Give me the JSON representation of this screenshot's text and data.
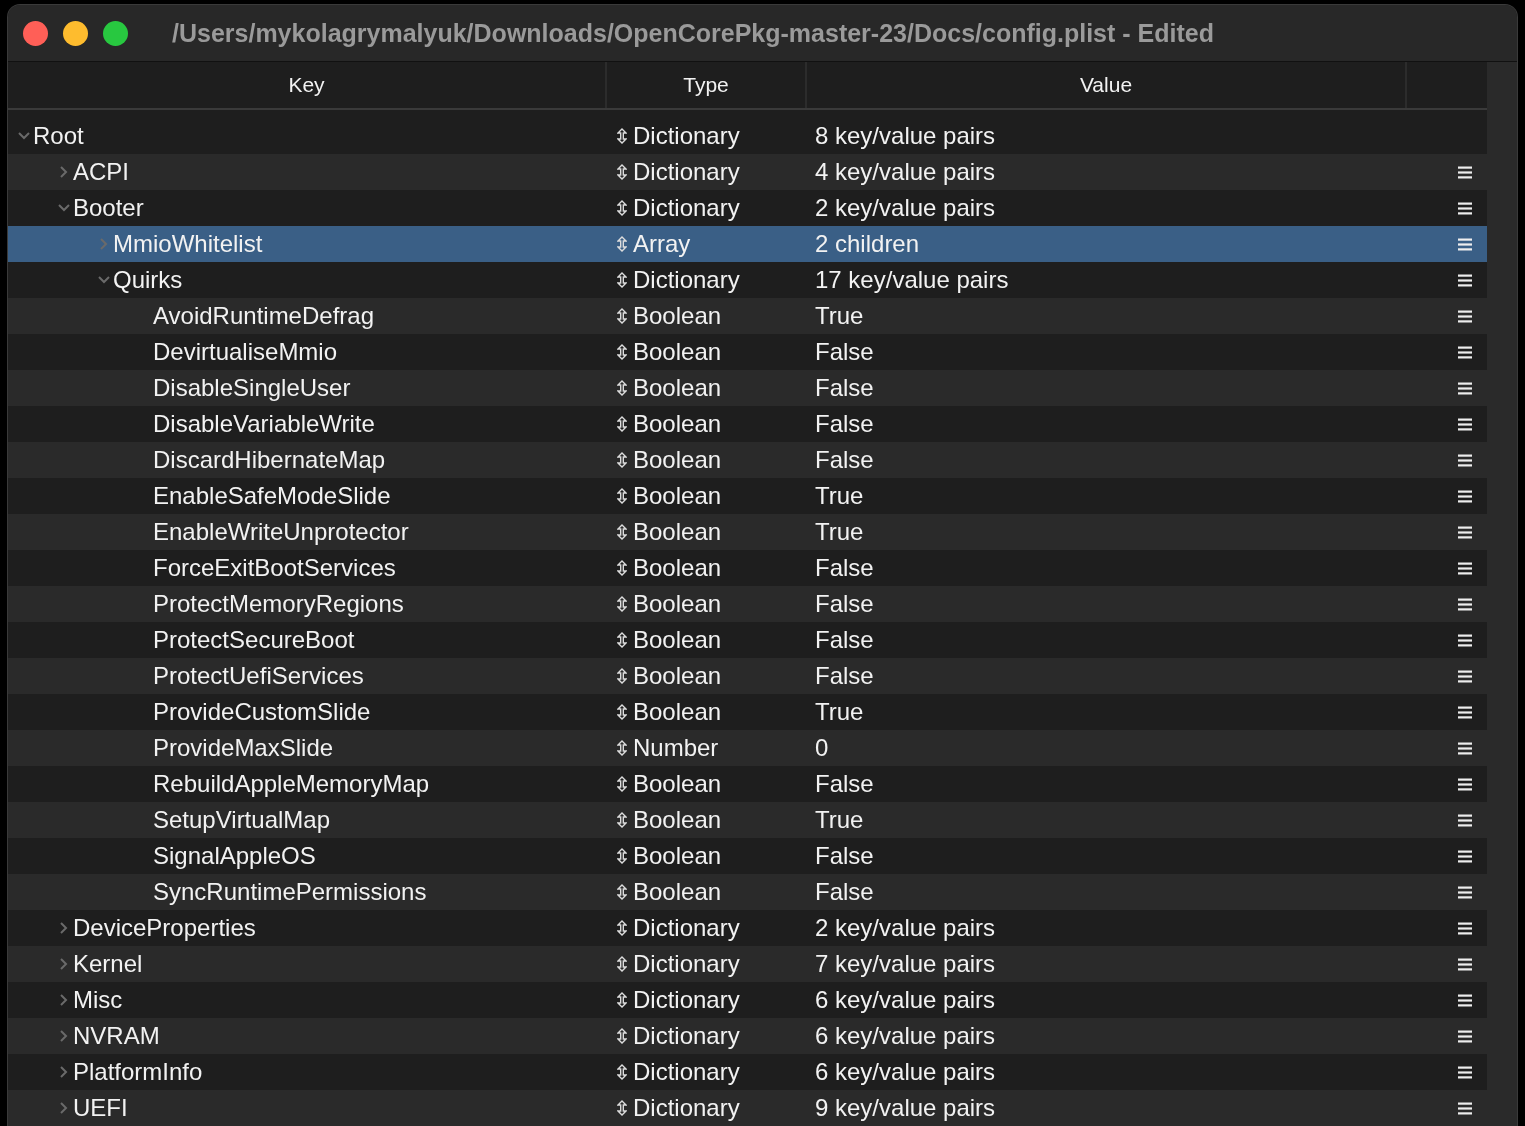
{
  "window": {
    "title": "/Users/mykolagrymalyuk/Downloads/OpenCorePkg-master-23/Docs/config.plist - Edited"
  },
  "table": {
    "columns": [
      "Key",
      "Type",
      "Value"
    ],
    "rows": [
      {
        "key": "Root",
        "type": "Dictionary",
        "value": "8 key/value pairs",
        "expanded": true,
        "selected": false,
        "children": [
          {
            "key": "ACPI",
            "type": "Dictionary",
            "value": "4 key/value pairs",
            "expanded": false,
            "selected": false
          },
          {
            "key": "Booter",
            "type": "Dictionary",
            "value": "2 key/value pairs",
            "expanded": true,
            "selected": false,
            "children": [
              {
                "key": "MmioWhitelist",
                "type": "Array",
                "value": "2 children",
                "expanded": false,
                "selected": true
              },
              {
                "key": "Quirks",
                "type": "Dictionary",
                "value": "17 key/value pairs",
                "expanded": true,
                "selected": false,
                "children": [
                  {
                    "key": "AvoidRuntimeDefrag",
                    "type": "Boolean",
                    "value": "True",
                    "selected": false
                  },
                  {
                    "key": "DevirtualiseMmio",
                    "type": "Boolean",
                    "value": "False",
                    "selected": false
                  },
                  {
                    "key": "DisableSingleUser",
                    "type": "Boolean",
                    "value": "False",
                    "selected": false
                  },
                  {
                    "key": "DisableVariableWrite",
                    "type": "Boolean",
                    "value": "False",
                    "selected": false
                  },
                  {
                    "key": "DiscardHibernateMap",
                    "type": "Boolean",
                    "value": "False",
                    "selected": false
                  },
                  {
                    "key": "EnableSafeModeSlide",
                    "type": "Boolean",
                    "value": "True",
                    "selected": false
                  },
                  {
                    "key": "EnableWriteUnprotector",
                    "type": "Boolean",
                    "value": "True",
                    "selected": false
                  },
                  {
                    "key": "ForceExitBootServices",
                    "type": "Boolean",
                    "value": "False",
                    "selected": false
                  },
                  {
                    "key": "ProtectMemoryRegions",
                    "type": "Boolean",
                    "value": "False",
                    "selected": false
                  },
                  {
                    "key": "ProtectSecureBoot",
                    "type": "Boolean",
                    "value": "False",
                    "selected": false
                  },
                  {
                    "key": "ProtectUefiServices",
                    "type": "Boolean",
                    "value": "False",
                    "selected": false
                  },
                  {
                    "key": "ProvideCustomSlide",
                    "type": "Boolean",
                    "value": "True",
                    "selected": false
                  },
                  {
                    "key": "ProvideMaxSlide",
                    "type": "Number",
                    "value": "0",
                    "selected": false
                  },
                  {
                    "key": "RebuildAppleMemoryMap",
                    "type": "Boolean",
                    "value": "False",
                    "selected": false
                  },
                  {
                    "key": "SetupVirtualMap",
                    "type": "Boolean",
                    "value": "True",
                    "selected": false
                  },
                  {
                    "key": "SignalAppleOS",
                    "type": "Boolean",
                    "value": "False",
                    "selected": false
                  },
                  {
                    "key": "SyncRuntimePermissions",
                    "type": "Boolean",
                    "value": "False",
                    "selected": false
                  }
                ]
              }
            ]
          },
          {
            "key": "DeviceProperties",
            "type": "Dictionary",
            "value": "2 key/value pairs",
            "expanded": false,
            "selected": false
          },
          {
            "key": "Kernel",
            "type": "Dictionary",
            "value": "7 key/value pairs",
            "expanded": false,
            "selected": false
          },
          {
            "key": "Misc",
            "type": "Dictionary",
            "value": "6 key/value pairs",
            "expanded": false,
            "selected": false
          },
          {
            "key": "NVRAM",
            "type": "Dictionary",
            "value": "6 key/value pairs",
            "expanded": false,
            "selected": false
          },
          {
            "key": "PlatformInfo",
            "type": "Dictionary",
            "value": "6 key/value pairs",
            "expanded": false,
            "selected": false
          },
          {
            "key": "UEFI",
            "type": "Dictionary",
            "value": "9 key/value pairs",
            "expanded": false,
            "selected": false
          }
        ]
      }
    ]
  }
}
